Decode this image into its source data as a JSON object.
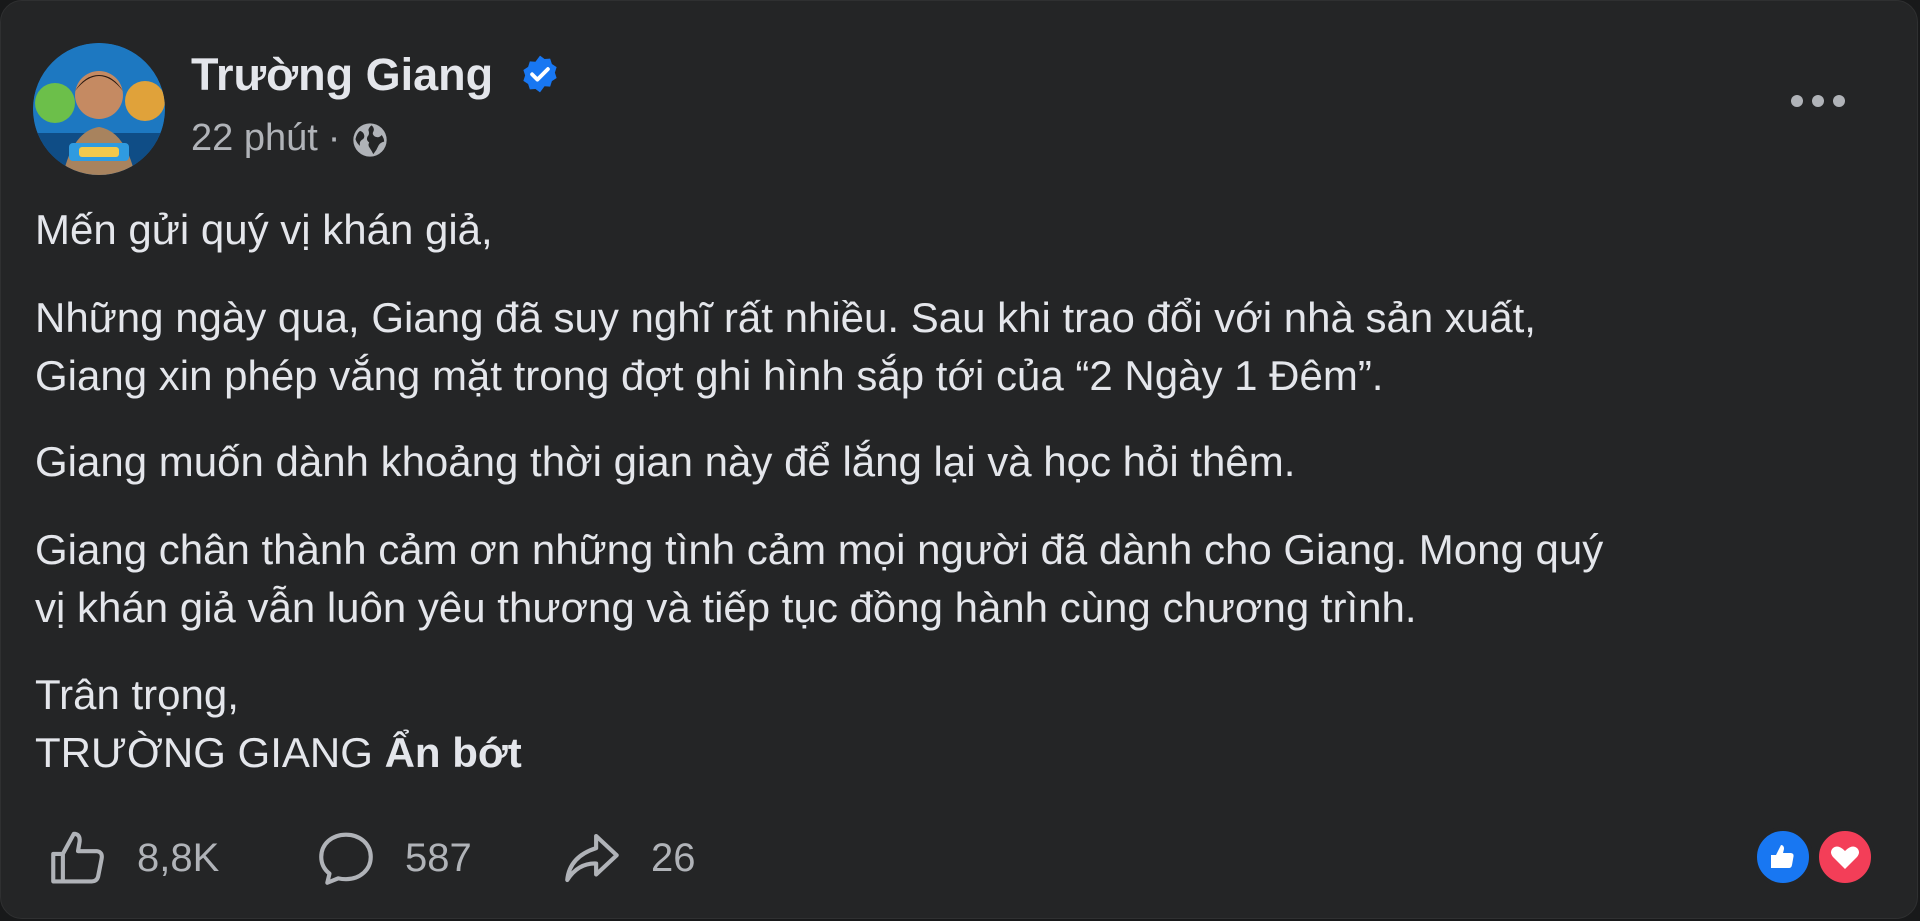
{
  "post": {
    "author": "Trường Giang",
    "timestamp": "22 phút",
    "separator": "·",
    "audience_icon": "globe-icon",
    "verified_icon": "verified-badge-icon",
    "verified_color": "#1877f2",
    "paragraphs": {
      "greeting": "Mến gửi quý vị khán giả,",
      "p2_line1": "Những ngày qua, Giang đã suy nghĩ rất nhiều. Sau khi trao đổi với nhà sản xuất,",
      "p2_line2": "Giang xin phép vắng mặt trong đợt ghi hình sắp tới của “2 Ngày 1 Đêm”.",
      "p3": "Giang muốn dành khoảng thời gian này để lắng lại và học hỏi thêm.",
      "p4_line1": "Giang chân thành cảm ơn những tình cảm mọi người đã dành cho Giang. Mong quý",
      "p4_line2": "vị khán giả vẫn luôn yêu thương và tiếp tục đồng hành cùng chương trình.",
      "closing": "Trân trọng,",
      "signature": "TRƯỜNG GIANG"
    },
    "see_less": "Ẩn bớt"
  },
  "actions": {
    "likes": "8,8K",
    "comments": "587",
    "shares": "26"
  },
  "reactions": {
    "like_color": "#1877f2",
    "love_color": "#f33e58"
  },
  "colors": {
    "card_bg": "#242526",
    "text_primary": "#e4e6eb",
    "text_secondary": "#b0b3b8"
  }
}
